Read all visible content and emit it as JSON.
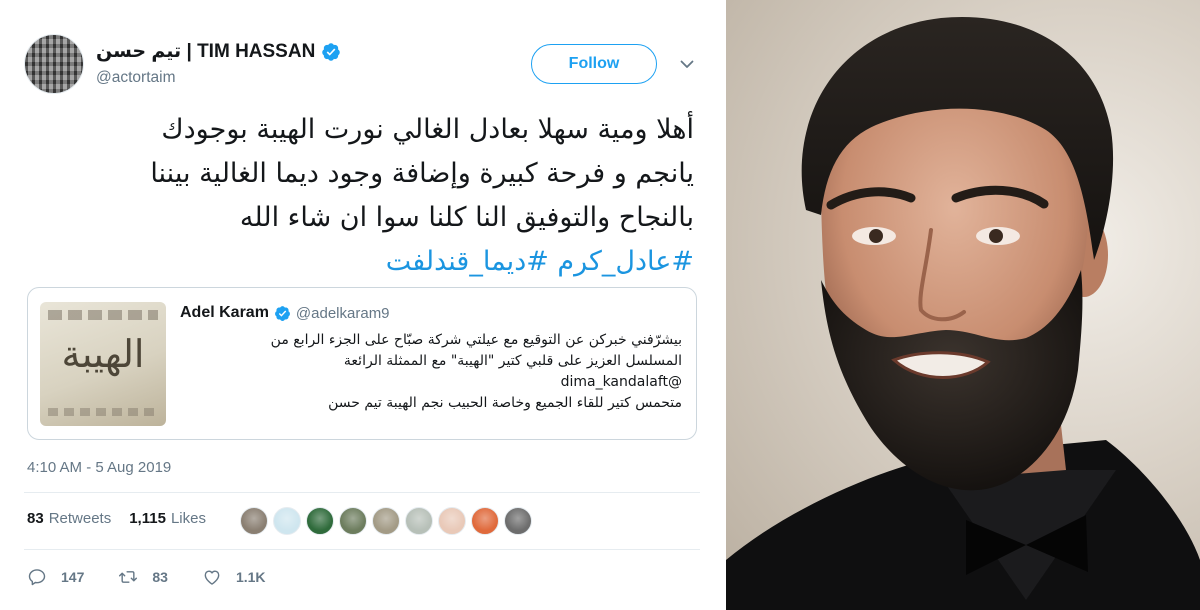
{
  "tweet": {
    "author": {
      "display_name": "تيم حسن | TIM HASSAN",
      "handle": "@actortaim",
      "avatar_icon": "avatar-icon",
      "verified_icon": "verified-badge-icon"
    },
    "follow_label": "Follow",
    "menu_icon": "chevron-down-icon",
    "text_lines": [
      "أهلا ومية سهلا بعادل الغالي نورت الهيبة بوجودك",
      "يانجم و فرحة كبيرة وإضافة وجود ديما الغالية بيننا",
      "بالنجاح والتوفيق النا كلنا سوا ان شاء الله"
    ],
    "hashtags": "#عادل_كرم #ديما_قندلفت",
    "quote": {
      "name": "Adel Karam",
      "handle": "@adelkaram9",
      "thumbnail_title": "الهيبة",
      "text_lines": [
        "بيشرّفني خبركن عن التوقيع مع عيلتي شركة صبّاح على الجزء الرابع من",
        "المسلسل العزيز على قلبي كتير \"الهيبة\" مع الممثلة الرائعة",
        "@dima_kandalaft",
        "متحمس كتير للقاء الجميع وخاصة الحبيب نجم الهيبة تيم حسن"
      ]
    },
    "timestamp": "4:10 AM - 5 Aug 2019",
    "retweets_count": "83",
    "retweets_label": "Retweets",
    "likes_count": "1,115",
    "likes_label": "Likes",
    "liker_colors": [
      "#8a7f72",
      "#cfe6ef",
      "#2f6b3b",
      "#6d7d5e",
      "#a39b86",
      "#b7c0b8",
      "#e9c9b8",
      "#e06a3c",
      "#6d6d6d"
    ],
    "actions": {
      "reply_count": "147",
      "retweet_count": "83",
      "like_count": "1.1K"
    }
  },
  "colors": {
    "accent": "#1da1f2",
    "hashtag": "#1b95e0",
    "muted": "#657786"
  }
}
